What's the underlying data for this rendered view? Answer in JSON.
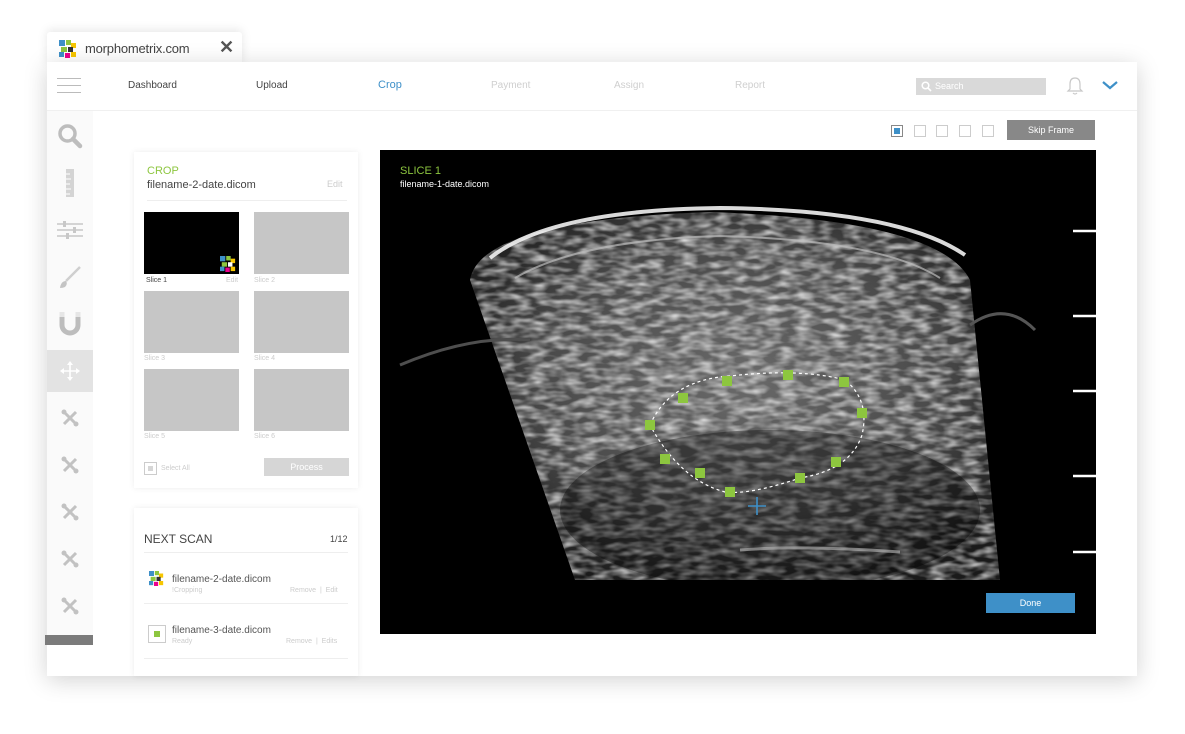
{
  "browser": {
    "tab_title": "morphometrix.com",
    "close_icon": "close-icon",
    "logo_colors": [
      "#8dc63f",
      "#3e90c8",
      "#ec008c",
      "#f7c600",
      "#333333"
    ]
  },
  "nav": {
    "items": [
      {
        "label": "Dashboard",
        "state": "done"
      },
      {
        "label": "Upload",
        "state": "done"
      },
      {
        "label": "Crop",
        "state": "active"
      },
      {
        "label": "Payment",
        "state": "disabled"
      },
      {
        "label": "Assign",
        "state": "disabled"
      },
      {
        "label": "Report",
        "state": "disabled"
      }
    ],
    "search_placeholder": "Search",
    "icons": [
      "menu-icon",
      "search-icon",
      "bell-icon",
      "chevron-down-icon"
    ]
  },
  "sidebar": {
    "tools": [
      "zoom-icon",
      "ruler-icon",
      "sliders-icon",
      "brush-icon",
      "magnet-icon",
      "move-icon",
      "tools-icon",
      "tools-icon",
      "tools-icon",
      "tools-icon",
      "tools-icon"
    ],
    "active_tool": "move-icon"
  },
  "toolbar": {
    "frame_layouts": 5,
    "selected_layout": 0,
    "skip_label": "Skip Frame"
  },
  "crop_panel": {
    "title": "CROP",
    "filename": "filename-2-date.dicom",
    "edit_label": "Edit",
    "slices": [
      {
        "label": "Slice 1",
        "edit": "Edit",
        "active": true
      },
      {
        "label": "Slice 2"
      },
      {
        "label": "Slice 3"
      },
      {
        "label": "Slice 4"
      },
      {
        "label": "Slice 5"
      },
      {
        "label": "Slice 6"
      }
    ],
    "select_all_label": "Select All",
    "process_label": "Process"
  },
  "next_scan": {
    "title": "NEXT SCAN",
    "count": "1/12",
    "files": [
      {
        "name": "filename-2-date.dicom",
        "status": "!Cropping",
        "actions": "Remove  |  Edit"
      },
      {
        "name": "filename-3-date.dicom",
        "status": "Ready",
        "actions": "Remove  |  Edits"
      }
    ]
  },
  "viewer": {
    "slice_title": "SLICE 1",
    "filename": "filename-1-date.dicom",
    "done_label": "Done",
    "accent": "#8dc63f",
    "cursor_color": "#3e90c8"
  }
}
